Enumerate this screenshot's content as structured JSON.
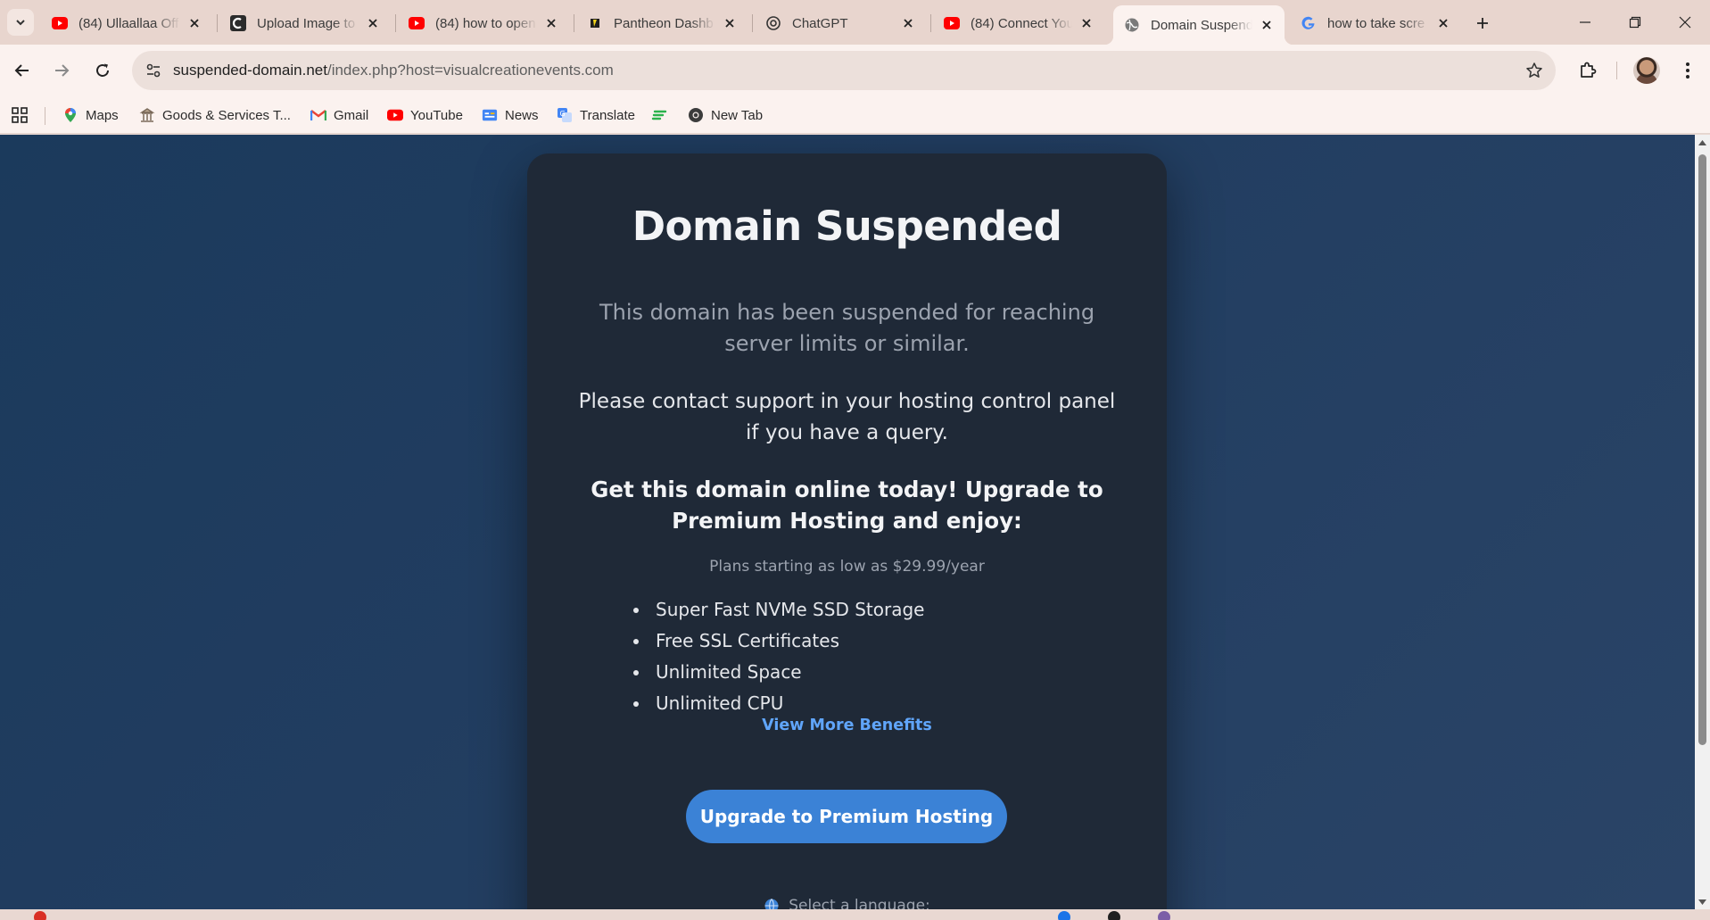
{
  "browser": {
    "tabs": [
      {
        "title": "(84) Ullaallaa Off",
        "favicon": "youtube-icon"
      },
      {
        "title": "Upload Image to",
        "favicon": "c-logo-icon"
      },
      {
        "title": "(84) how to open",
        "favicon": "youtube-icon"
      },
      {
        "title": "Pantheon Dashb",
        "favicon": "pantheon-icon"
      },
      {
        "title": "ChatGPT",
        "favicon": "chatgpt-icon"
      },
      {
        "title": "(84) Connect You",
        "favicon": "youtube-icon"
      },
      {
        "title": "Domain Suspend",
        "favicon": "globe-icon",
        "active": true
      },
      {
        "title": "how to take scre",
        "favicon": "google-icon"
      }
    ],
    "address": {
      "host": "suspended-domain.net",
      "path": "/index.php?host=visualcreationevents.com"
    },
    "bookmarks": [
      {
        "label": "Maps",
        "icon": "maps-pin-icon"
      },
      {
        "label": "Goods & Services T...",
        "icon": "gst-icon"
      },
      {
        "label": "Gmail",
        "icon": "gmail-icon"
      },
      {
        "label": "YouTube",
        "icon": "youtube-icon"
      },
      {
        "label": "News",
        "icon": "news-icon"
      },
      {
        "label": "Translate",
        "icon": "translate-icon"
      },
      {
        "label": "",
        "icon": "feedly-icon"
      },
      {
        "label": "New Tab",
        "icon": "chrome-icon"
      }
    ]
  },
  "page": {
    "title": "Domain Suspended",
    "subtitle": "This domain has been suspended for reaching server limits or similar.",
    "contact": "Please contact support in your hosting control panel if you have a query.",
    "promo": "Get this domain online today! Upgrade to Premium Hosting and enjoy:",
    "price": "Plans starting as low as $29.99/year",
    "benefits": [
      "Super Fast NVMe SSD Storage",
      "Free SSL Certificates",
      "Unlimited Space",
      "Unlimited CPU"
    ],
    "more_link": "View More Benefits",
    "cta": "Upgrade to Premium Hosting",
    "language_label": "Select a language:"
  },
  "colors": {
    "page_bg": "#1f3d60",
    "card_bg": "#1f2937",
    "accent": "#3b82d6",
    "link": "#60a5fa"
  }
}
